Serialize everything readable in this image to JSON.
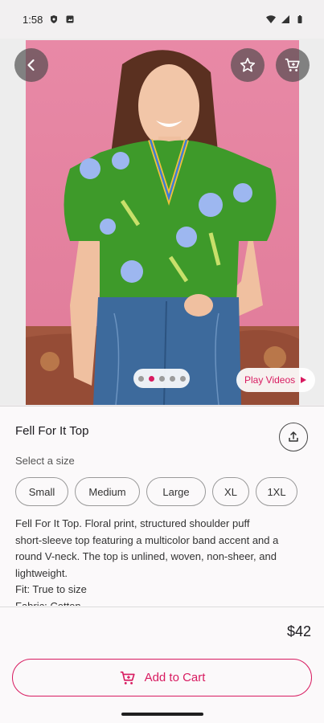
{
  "status_bar": {
    "time": "1:58"
  },
  "product": {
    "title": "Fell For It Top",
    "select_size_label": "Select a size",
    "sizes": [
      "Small",
      "Medium",
      "Large",
      "XL",
      "1XL"
    ],
    "description_lines": [
      "Fell For It Top. Floral print, structured shoulder puff",
      "short-sleeve top featuring a multicolor band accent and a",
      "round V-neck. The top is unlined, woven, non-sheer, and",
      "lightweight.",
      "Fit: True to size",
      "Fabric: Cotton"
    ],
    "price": "$42"
  },
  "gallery": {
    "image_count": 5,
    "active_index": 1,
    "play_videos_label": "Play Videos"
  },
  "actions": {
    "add_to_cart_label": "Add to Cart"
  },
  "colors": {
    "accent": "#d81b60",
    "photo_bg": "#e58aa6",
    "top_green": "#3e9a2a",
    "jeans": "#3d6a9c"
  },
  "icons": {
    "back": "arrow-left-icon",
    "favorite": "star-outline-icon",
    "cart": "cart-icon",
    "share": "share-upload-icon",
    "play": "play-triangle-icon"
  }
}
